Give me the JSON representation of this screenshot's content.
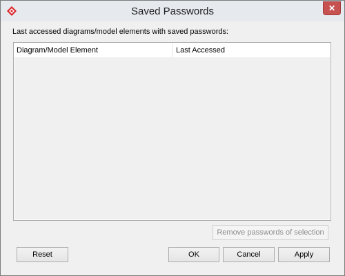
{
  "window": {
    "title": "Saved Passwords",
    "close_glyph": "✕",
    "app_icon": "visual-paradigm-diamond-icon",
    "accent_color": "#d9262b"
  },
  "description": "Last accessed diagrams/model elements with saved passwords:",
  "table": {
    "columns": [
      "Diagram/Model Element",
      "Last Accessed"
    ],
    "rows": []
  },
  "buttons": {
    "remove": "Remove passwords of selection",
    "reset": "Reset",
    "ok": "OK",
    "cancel": "Cancel",
    "apply": "Apply"
  }
}
